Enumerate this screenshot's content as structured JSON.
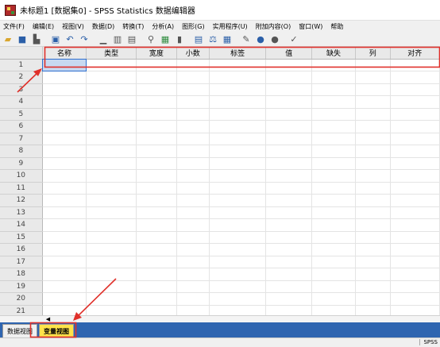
{
  "window": {
    "title": "未标题1 [数据集0] - SPSS Statistics 数据编辑器"
  },
  "menu": [
    "文件(F)",
    "编辑(E)",
    "视图(V)",
    "数据(D)",
    "转换(T)",
    "分析(A)",
    "图形(G)",
    "实用程序(U)",
    "附加内容(O)",
    "窗口(W)",
    "帮助"
  ],
  "toolbar": {
    "icons": [
      "open-icon",
      "save-icon",
      "print-icon",
      "dialog-recall-icon",
      "undo-icon",
      "redo-icon",
      "goto-case-icon",
      "goto-variable-icon",
      "variables-icon",
      "find-icon",
      "insert-cases-icon",
      "insert-variable-icon",
      "split-file-icon",
      "weight-cases-icon",
      "select-cases-icon",
      "value-labels-icon",
      "use-sets-icon",
      "show-all-variables-icon",
      "spell-check-icon"
    ]
  },
  "grid": {
    "columns": [
      "名称",
      "类型",
      "宽度",
      "小数",
      "标签",
      "值",
      "缺失",
      "列",
      "对齐"
    ],
    "rows": [
      "1",
      "2",
      "3",
      "4",
      "5",
      "6",
      "7",
      "8",
      "9",
      "10",
      "11",
      "12",
      "13",
      "14",
      "15",
      "16",
      "17",
      "18",
      "19",
      "20",
      "21"
    ]
  },
  "tabs": {
    "data_view": "数据视图",
    "variable_view": "变量视图"
  },
  "status": {
    "text": "SPSS"
  },
  "colors": {
    "tab_active": "#ffe34a",
    "tab_bar": "#2f65b0",
    "annotation": "#e0302a",
    "selection": "#c7d9f1"
  }
}
